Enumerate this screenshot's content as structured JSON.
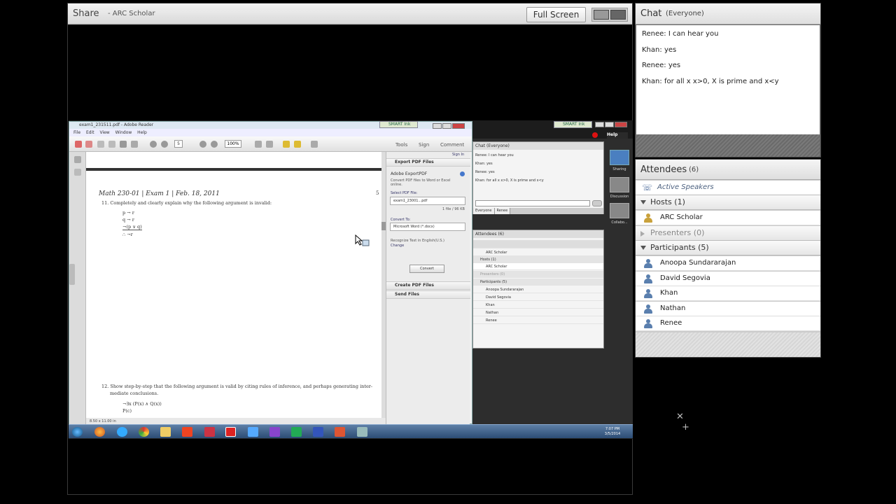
{
  "share": {
    "title": "Share",
    "subtitle": "- ARC Scholar",
    "fullscreen_label": "Full Screen"
  },
  "shared_screen": {
    "reader": {
      "title": "exam1_231511.pdf - Adobe Reader",
      "menu": "File  Edit  View  Window  Help",
      "page_number": "5",
      "zoom": "100%",
      "tab_tools": "Tools",
      "tab_sign": "Sign",
      "tab_comment": "Comment",
      "doc_header": "Math 230-01 | Exam 1 | Feb. 18, 2011",
      "doc_page_num": "5",
      "q11": "11.  Completely and clearly explain why the following argument is invalid:",
      "premises": [
        "p → r",
        "q → r",
        "¬(p ∨ q)",
        "∴ ¬r"
      ],
      "q12": "12.  Show step-by-step that the following argument is valid by citing rules of inference, and perhaps generating inter-",
      "q12b": "mediate conclusions.",
      "formulas": [
        "¬∃x (P(x) ∧ Q(x))",
        "P(c)"
      ],
      "page_size": "8.50 x 11.00 in",
      "panel": {
        "sign_in": "Sign In",
        "export_head": "Export PDF Files",
        "export_title": "Adobe ExportPDF",
        "export_desc": "Convert PDF files to Word or Excel online.",
        "select_label": "Select PDF File:",
        "file_value": "exam1_23001...pdf",
        "file_count": "1 file / 96 KB",
        "convert_label": "Convert To:",
        "convert_value": "Microsoft Word (*.docx)",
        "recognize": "Recognize Text in English(U.S.)",
        "change": "Change",
        "convert_btn": "Convert",
        "create_head": "Create PDF Files",
        "send_head": "Send Files"
      }
    },
    "smart_tag": "SMART Ink",
    "help": "Help",
    "mini_chat": {
      "title": "Chat",
      "sub": "(Everyone)",
      "lines": [
        "Renee: I can hear you",
        "Khan: yes",
        "Renee: yes",
        "Khan: for all x x>0, X is prime and x<y"
      ],
      "tabs": [
        "Everyone",
        "Renee"
      ]
    },
    "mini_attendees": {
      "title": "Attendees",
      "count": "(6)",
      "active": "ARC Scholar",
      "hosts": "Hosts (1)",
      "host_name": "ARC Scholar",
      "presenters": "Presenters (0)",
      "participants": "Participants (5)",
      "names": [
        "Anoopa Sundararajan",
        "David Segovia",
        "Khan",
        "Nathan",
        "Renee"
      ]
    },
    "side_labels": [
      "Sharing",
      "Discussion",
      "Collabo..."
    ],
    "clock_time": "7:07 PM",
    "clock_date": "3/5/2014"
  },
  "chat": {
    "title": "Chat",
    "audience": "(Everyone)",
    "messages": [
      {
        "sender": "Renee",
        "text": "I can hear you"
      },
      {
        "sender": "Khan",
        "text": "yes"
      },
      {
        "sender": "Renee",
        "text": "yes"
      },
      {
        "sender": "Khan",
        "text": "for all x x>0, X is prime and x<y"
      }
    ]
  },
  "attendees": {
    "title": "Attendees",
    "count": "(6)",
    "active_speakers": "Active Speakers",
    "hosts_label": "Hosts (1)",
    "hosts": [
      "ARC Scholar"
    ],
    "presenters_label": "Presenters (0)",
    "participants_label": "Participants (5)",
    "participants": [
      "Anoopa Sundararajan",
      "David Segovia",
      "Khan",
      "Nathan",
      "Renee"
    ]
  },
  "colors": {
    "accent_blue": "#5a7fae",
    "host_gold": "#c9a13b"
  },
  "icons": {
    "bottom_tools": [
      "close-icon",
      "plus-icon"
    ]
  }
}
